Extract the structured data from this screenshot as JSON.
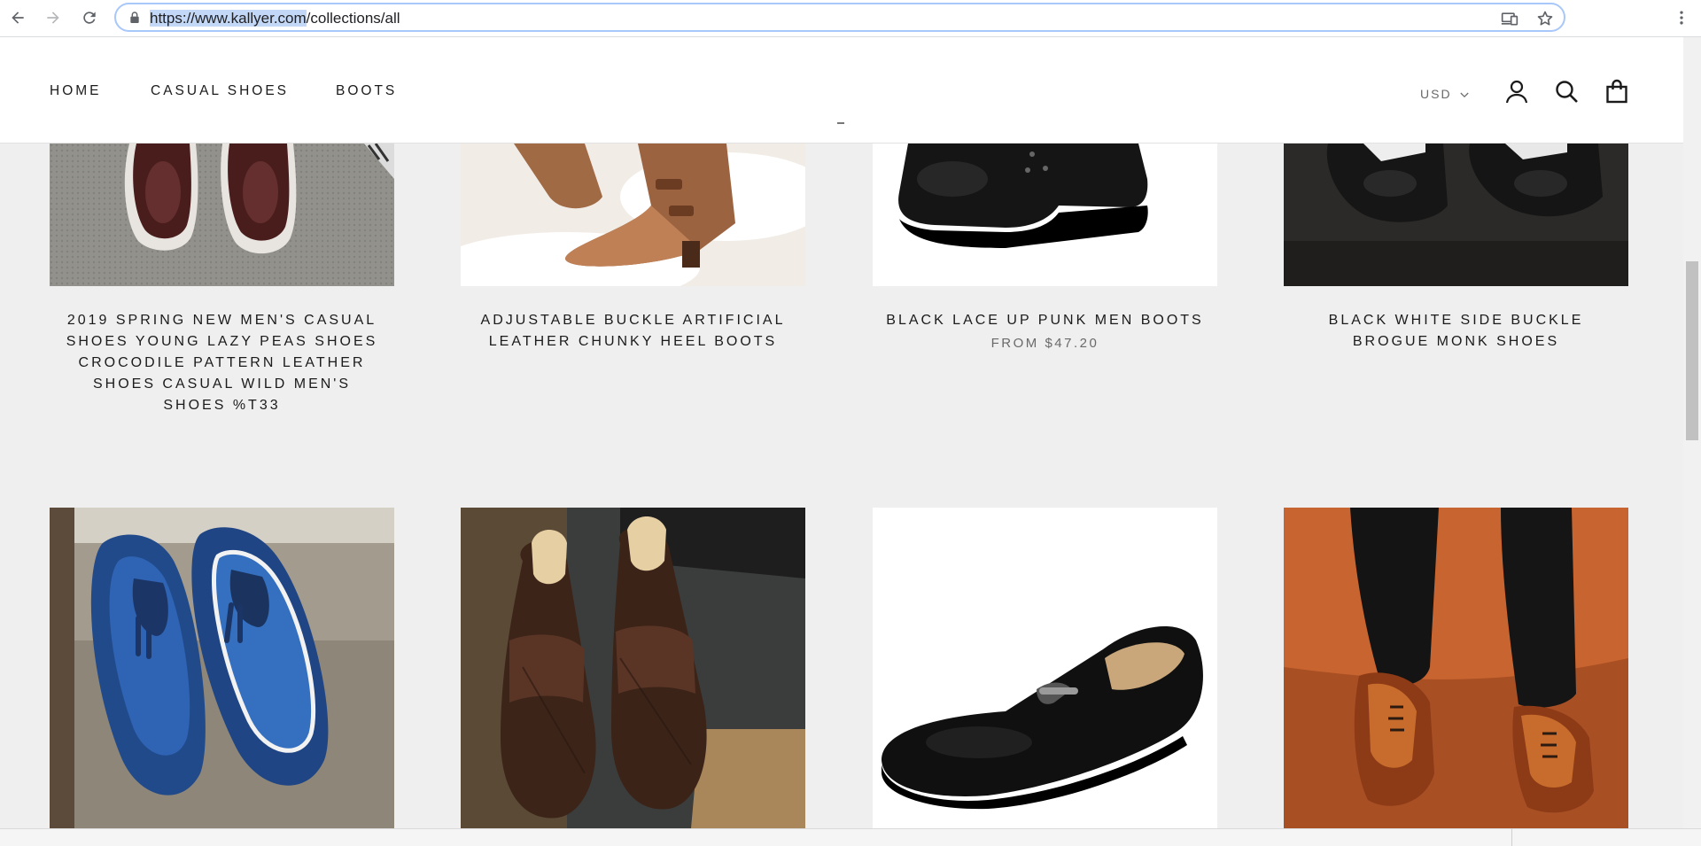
{
  "browser": {
    "url_highlight": "https://www.kallyer.com",
    "url_rest": "/collections/all",
    "icons": [
      "back-arrow-icon",
      "forward-arrow-icon",
      "reload-icon",
      "lock-icon",
      "install-app-icon",
      "star-icon",
      "more-vert-icon"
    ]
  },
  "header": {
    "nav": [
      {
        "label": "HOME"
      },
      {
        "label": "CASUAL SHOES"
      },
      {
        "label": "BOOTS"
      }
    ],
    "currency": "USD",
    "icons": [
      "account-icon",
      "search-icon",
      "cart-bag-icon",
      "chevron-down-icon"
    ]
  },
  "products": [
    {
      "title": "2019 SPRING NEW MEN'S CASUAL SHOES YOUNG LAZY PEAS SHOES CROCODILE PATTERN LEATHER SHOES CASUAL WILD MEN'S SHOES %T33",
      "price": ""
    },
    {
      "title": "ADJUSTABLE BUCKLE ARTIFICIAL LEATHER CHUNKY HEEL BOOTS",
      "price": ""
    },
    {
      "title": "BLACK LACE UP PUNK MEN BOOTS",
      "price": "FROM $47.20"
    },
    {
      "title": "BLACK WHITE SIDE BUCKLE BROGUE MONK SHOES",
      "price": ""
    },
    {
      "title": "",
      "price": ""
    },
    {
      "title": "",
      "price": ""
    },
    {
      "title": "",
      "price": ""
    },
    {
      "title": "",
      "price": ""
    }
  ],
  "colors": {
    "page_bg": "#efefef",
    "header_bg": "#ffffff",
    "text": "#1c1b1b",
    "muted": "#6a6a6a",
    "omnibox_border": "#a8c7fa",
    "selection": "#c3d7f6"
  }
}
